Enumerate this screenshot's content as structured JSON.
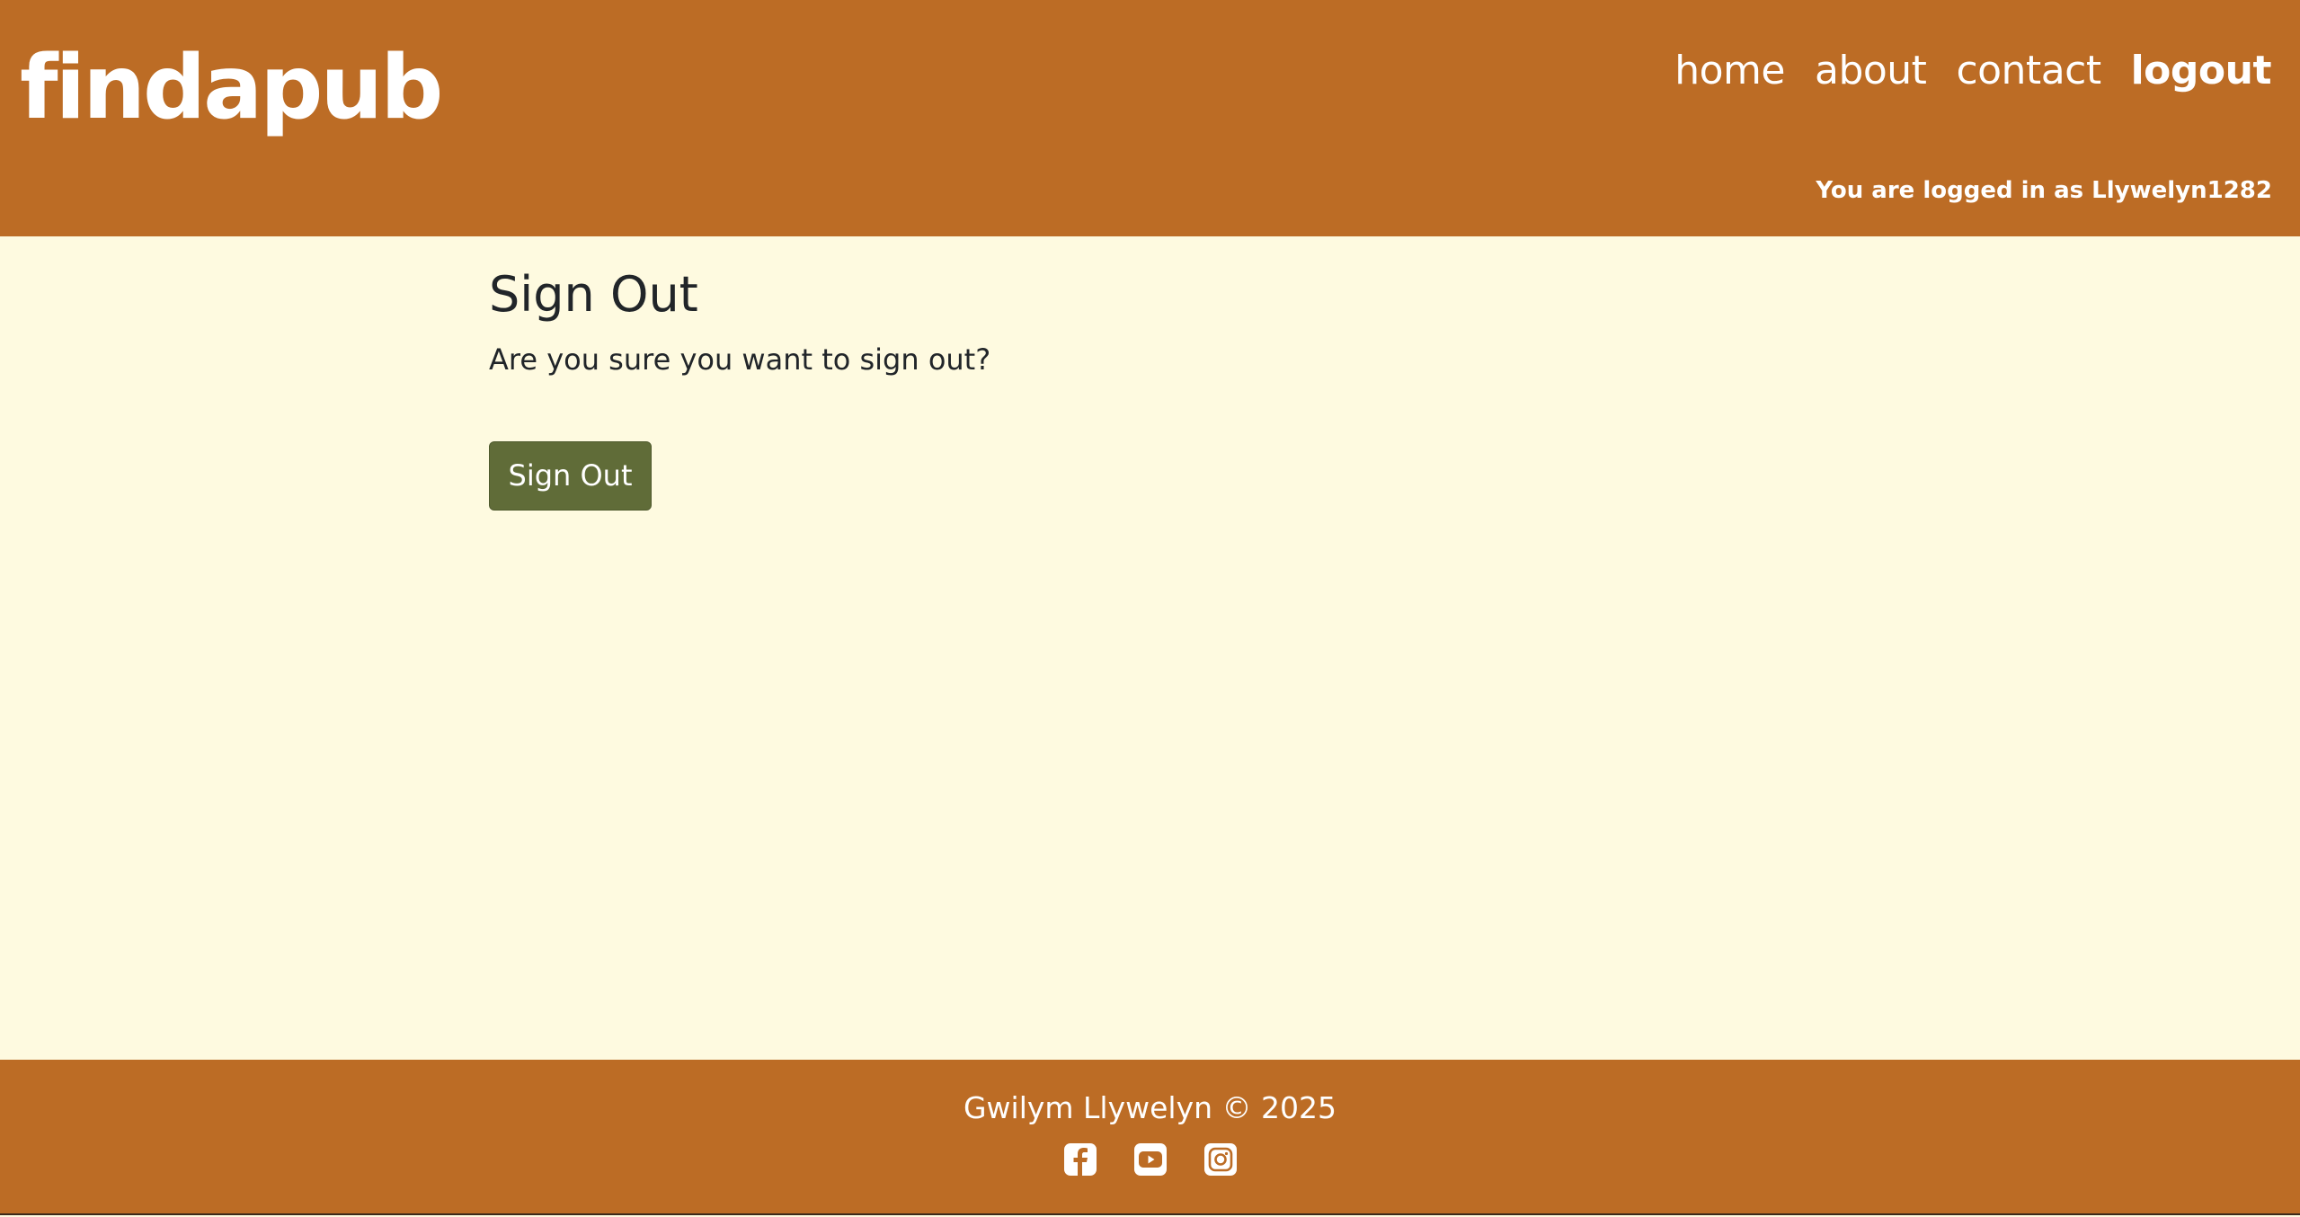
{
  "header": {
    "brand": "findapub",
    "nav": [
      {
        "label": "home"
      },
      {
        "label": "about"
      },
      {
        "label": "contact"
      },
      {
        "label": "logout",
        "active": true
      }
    ],
    "login_status": "You are logged in as Llywelyn1282"
  },
  "main": {
    "title": "Sign Out",
    "message": "Are you sure you want to sign out?",
    "button_label": "Sign Out"
  },
  "footer": {
    "copyright": "Gwilym Llywelyn © 2025",
    "social_icons": [
      "facebook-icon",
      "youtube-icon",
      "instagram-icon"
    ]
  },
  "colors": {
    "header_bg": "#bc6c25",
    "page_bg": "#fefae0",
    "button_bg": "#606c38",
    "text": "#212529"
  }
}
